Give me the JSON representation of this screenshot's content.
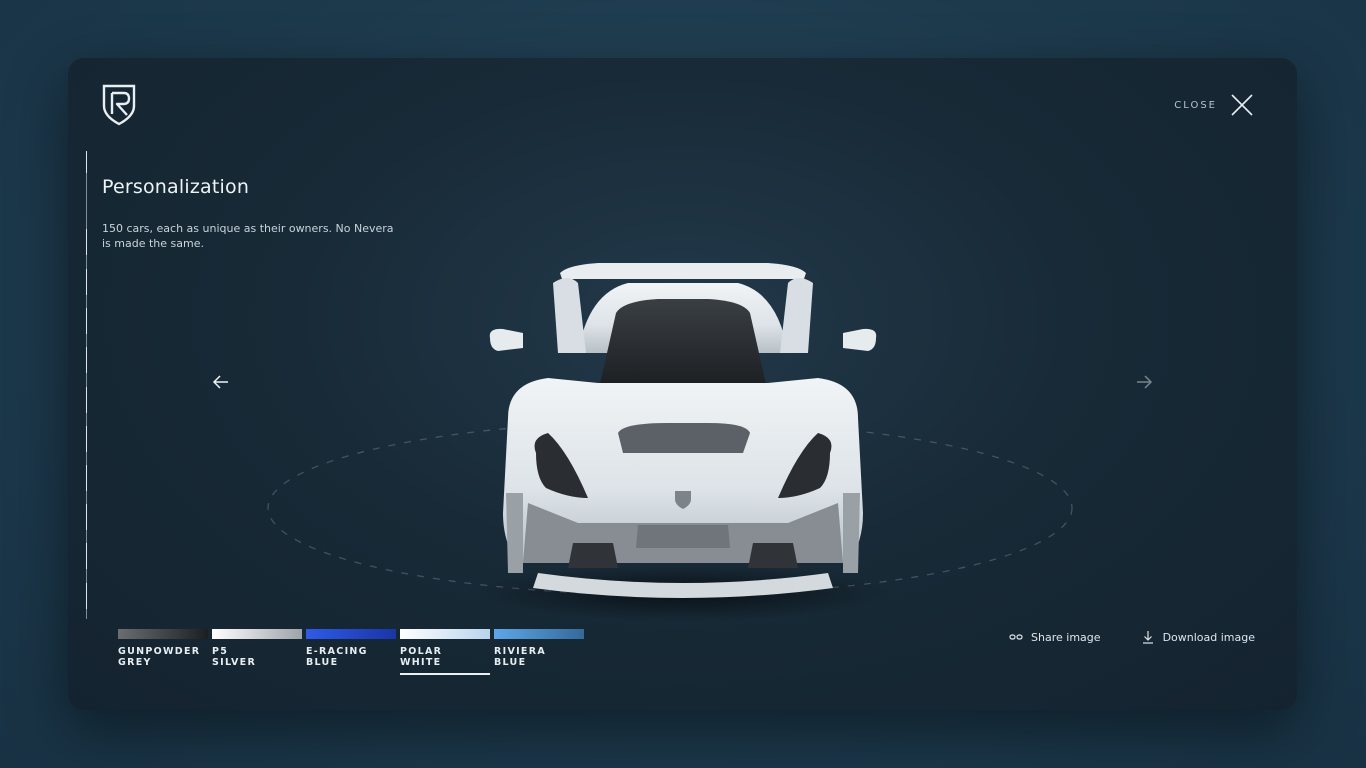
{
  "header": {
    "logo": "rimac-logo",
    "close_label": "CLOSE",
    "close_icon": "close-icon"
  },
  "panel": {
    "title": "Personalization",
    "description": "150 cars, each as unique as their owners. No Nevera is made the same."
  },
  "navigation": {
    "prev_icon": "arrow-left-icon",
    "next_icon": "arrow-right-icon"
  },
  "colors": {
    "selected": "POLAR WHITE",
    "options": [
      {
        "label_line1": "GUNPOWDER",
        "label_line2": "GREY",
        "from": "#6b6e70",
        "to": "#1c1f22"
      },
      {
        "label_line1": "P5",
        "label_line2": "SILVER",
        "from": "#ffffff",
        "to": "#9ea3a8"
      },
      {
        "label_line1": "E-RACING",
        "label_line2": "BLUE",
        "from": "#2f5be8",
        "to": "#1a35a6"
      },
      {
        "label_line1": "POLAR",
        "label_line2": "WHITE",
        "from": "#ffffff",
        "to": "#b9d4ec"
      },
      {
        "label_line1": "RIVIERA",
        "label_line2": "BLUE",
        "from": "#5ea7e8",
        "to": "#35699a"
      }
    ]
  },
  "actions": {
    "share_label": "Share image",
    "share_icon": "link-icon",
    "download_label": "Download image",
    "download_icon": "download-icon"
  }
}
